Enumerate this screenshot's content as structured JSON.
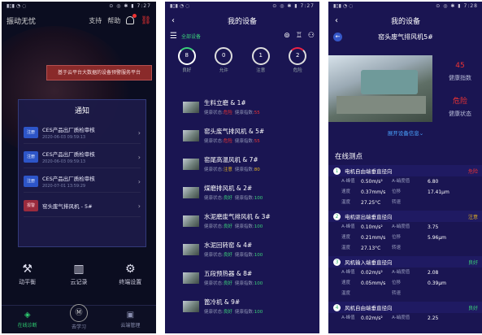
{
  "screen1": {
    "status_left": "▮▯▮ ◔ ◌",
    "status_right": "⊙ ◎ ✱ ▮ 7:27",
    "title": "振动无忧",
    "support": "支持",
    "help": "帮助",
    "banner": "基于云平台大数据的设备预警服务平台",
    "notice_title": "通知",
    "notices": [
      {
        "tag": "注册",
        "tag_color": "blue",
        "title": "CES产品出厂质检审核",
        "date": "2020-06-03 09:59:13"
      },
      {
        "tag": "注册",
        "tag_color": "blue",
        "title": "CES产品出厂质检审核",
        "date": "2020-06-03 09:59:13"
      },
      {
        "tag": "注册",
        "tag_color": "blue",
        "title": "CES产品出厂质检审核",
        "date": "2020-07-01 13:59:29"
      },
      {
        "tag": "报警",
        "tag_color": "red",
        "title": "窑头废气排风机 - 5#",
        "date": ""
      }
    ],
    "functions": [
      {
        "icon": "⚒",
        "label": "动平衡"
      },
      {
        "icon": "▥",
        "label": "云记录"
      },
      {
        "icon": "⚙",
        "label": "终端设置"
      }
    ],
    "tabs": [
      {
        "icon": "◈",
        "label": "在线诊断",
        "active": true
      },
      {
        "icon": "Ⓜ",
        "label": "去学习",
        "active": false
      },
      {
        "icon": "▣",
        "label": "云端管理",
        "active": false
      }
    ]
  },
  "screen2": {
    "status_left": "▮▯▮ ◔ ◌",
    "status_right": "⊙ ◎ ✱ ▮ 7:27",
    "title": "我的设备",
    "filter_label": "全部设备",
    "stats": [
      {
        "value": "8",
        "label": "良好",
        "kind": "good"
      },
      {
        "value": "0",
        "label": "允许",
        "kind": "warn"
      },
      {
        "value": "1",
        "label": "注意",
        "kind": "warn"
      },
      {
        "value": "2",
        "label": "危险",
        "kind": "dang"
      }
    ],
    "devices": [
      {
        "name": "生料立磨 & 1#",
        "status_label": "健康状态:",
        "status": "危险",
        "status_color": "red",
        "index_label": "健康指数:",
        "index": "55",
        "index_color": "red"
      },
      {
        "name": "窑头废气排风机 & 5#",
        "status_label": "健康状态:",
        "status": "危险",
        "status_color": "red",
        "index_label": "健康指数:",
        "index": "55",
        "index_color": "red"
      },
      {
        "name": "窑尾高温风机 & 7#",
        "status_label": "健康状态:",
        "status": "注意",
        "status_color": "yel",
        "index_label": "健康指数:",
        "index": "80",
        "index_color": "yel"
      },
      {
        "name": "煤磨排风机 & 2#",
        "status_label": "健康状态:",
        "status": "良好",
        "status_color": "grn",
        "index_label": "健康指数:",
        "index": "100",
        "index_color": "grn"
      },
      {
        "name": "水泥磨废气排风机 & 3#",
        "status_label": "健康状态:",
        "status": "良好",
        "status_color": "grn",
        "index_label": "健康指数:",
        "index": "100",
        "index_color": "grn"
      },
      {
        "name": "水泥回转窑 & 4#",
        "status_label": "健康状态:",
        "status": "良好",
        "status_color": "grn",
        "index_label": "健康指数:",
        "index": "100",
        "index_color": "grn"
      },
      {
        "name": "五段预热器 & 8#",
        "status_label": "健康状态:",
        "status": "良好",
        "status_color": "grn",
        "index_label": "健康指数:",
        "index": "100",
        "index_color": "grn"
      },
      {
        "name": "篦冷机 & 9#",
        "status_label": "健康状态:",
        "status": "良好",
        "status_color": "grn",
        "index_label": "健康指数:",
        "index": "100",
        "index_color": "grn"
      }
    ]
  },
  "screen3": {
    "status_left": "▮▯▮ ◔ ◌",
    "status_right": "⊙ ◎ ✱ ▮ 7:28",
    "title": "我的设备",
    "device_title": "窑头废气排风机5#",
    "health_index_value": "45",
    "health_index_label": "健康指数",
    "health_state_value": "危险",
    "health_state_label": "健康状态",
    "expand_label": "展开设备信息⌄",
    "section_title": "在线测点",
    "points": [
      {
        "num": "1",
        "name": "电机自由端垂直径向",
        "status": "危险",
        "status_color": "red",
        "rows": [
          [
            "A-峰值",
            "0.50m/s²",
            "A-峭度值",
            "6.80"
          ],
          [
            "速度",
            "0.37mm/s",
            "位移",
            "17.41μm"
          ],
          [
            "温度",
            "27.25°C",
            "转速",
            ""
          ]
        ]
      },
      {
        "num": "2",
        "name": "电机驱出端垂直径向",
        "status": "注意",
        "status_color": "yel",
        "rows": [
          [
            "A-峰值",
            "0.10m/s²",
            "A-峭度值",
            "3.75"
          ],
          [
            "速度",
            "0.21mm/s",
            "位移",
            "5.96μm"
          ],
          [
            "温度",
            "27.13°C",
            "转速",
            ""
          ]
        ]
      },
      {
        "num": "3",
        "name": "风机输入端垂直径向",
        "status": "良好",
        "status_color": "grn",
        "rows": [
          [
            "A-峰值",
            "0.02m/s²",
            "A-峭度值",
            "2.08"
          ],
          [
            "速度",
            "0.05mm/s",
            "位移",
            "0.39μm"
          ],
          [
            "温度",
            "",
            "转速",
            ""
          ]
        ]
      },
      {
        "num": "4",
        "name": "风机自由端垂直径向",
        "status": "良好",
        "status_color": "grn",
        "rows": [
          [
            "A-峰值",
            "0.02m/s²",
            "A-峭度值",
            "2.25"
          ]
        ]
      }
    ]
  }
}
